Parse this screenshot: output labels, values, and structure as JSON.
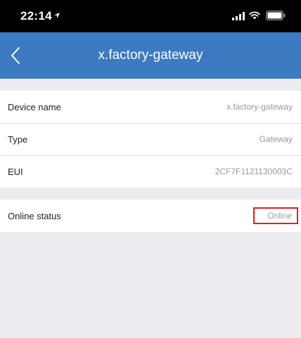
{
  "status_bar": {
    "time": "22:14",
    "icons": [
      "location-arrow-icon",
      "cellular-signal-icon",
      "wifi-icon",
      "battery-icon"
    ]
  },
  "nav": {
    "title": "x.factory-gateway",
    "back_icon": "chevron-left-icon",
    "background_color": "#3c7ac2"
  },
  "device_info": {
    "rows": [
      {
        "label": "Device name",
        "value": "x.factory-gateway"
      },
      {
        "label": "Type",
        "value": "Gateway"
      },
      {
        "label": "EUI",
        "value": "2CF7F1121130003C"
      }
    ]
  },
  "status_section": {
    "label": "Online status",
    "value": "Online",
    "highlight_color": "#e11d2a"
  }
}
